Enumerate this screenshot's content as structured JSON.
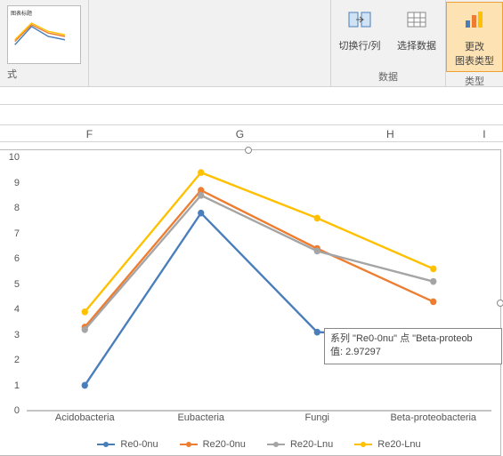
{
  "ribbon": {
    "preview_title": "图表标题",
    "style_group_label": "式",
    "data_group_label": "数据",
    "type_group_label": "类型",
    "switch_rowcol": "切换行/列",
    "select_data": "选择数据",
    "change_type_line1": "更改",
    "change_type_line2": "图表类型"
  },
  "columns": [
    "F",
    "G",
    "H",
    "I"
  ],
  "chart_data": {
    "type": "line",
    "categories": [
      "Acidobacteria",
      "Eubacteria",
      "Fungi",
      "Beta-proteobacteria"
    ],
    "series": [
      {
        "name": "Re0-0nu",
        "color": "#4a7ebb",
        "values": [
          1.0,
          7.8,
          3.1,
          2.97297
        ]
      },
      {
        "name": "Re20-0nu",
        "color": "#ed7d31",
        "values": [
          3.3,
          8.7,
          6.4,
          4.3
        ]
      },
      {
        "name": "Re20-Lnu",
        "color": "#a5a5a5",
        "values": [
          3.2,
          8.5,
          6.3,
          5.1
        ]
      },
      {
        "name": "Re20-Lnu",
        "color": "#ffc000",
        "values": [
          3.9,
          9.4,
          7.6,
          5.6
        ]
      }
    ],
    "ylim": [
      0,
      10
    ],
    "yticks": [
      0,
      1,
      2,
      3,
      4,
      5,
      6,
      7,
      8,
      9,
      10
    ]
  },
  "tooltip": {
    "line1": "系列 \"Re0-0nu\" 点 \"Beta-proteob",
    "line2": "值: 2.97297"
  }
}
